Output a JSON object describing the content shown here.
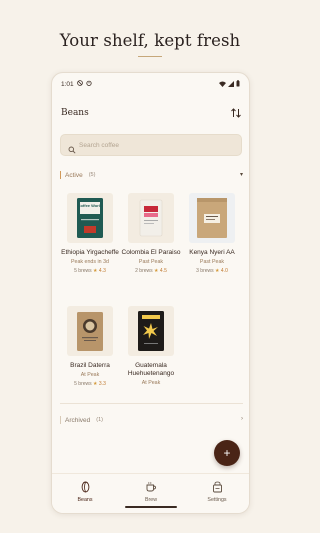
{
  "headline": "Your shelf, kept fresh",
  "status_bar": {
    "time": "1:01"
  },
  "appbar": {
    "title": "Beans",
    "sort_icon": "sort-arrows-icon"
  },
  "search": {
    "placeholder": "Search coffee",
    "value": ""
  },
  "active_section": {
    "label": "Active",
    "count": "(5)",
    "beans": [
      {
        "name": "Ethiopia Yirgacheffe",
        "status": "Peak ends in 3d",
        "brews": "5 brews",
        "rating": "4.3",
        "bag_color": "#1f5a52",
        "label_text": "Coffee World"
      },
      {
        "name": "Colombia El Paraiso",
        "status": "Past Peak",
        "brews": "2 brews",
        "rating": "4.5",
        "bag_color": "#f2efe9"
      },
      {
        "name": "Kenya Nyeri AA",
        "status": "Past Peak",
        "brews": "3 brews",
        "rating": "4.0",
        "bag_color": "#c9a77a"
      },
      {
        "name": "Brazil Daterra",
        "status": "At Peak",
        "brews": "5 brews",
        "rating": "3.3",
        "bag_color": "#b8956a"
      },
      {
        "name": "Guatemala Huehuetenango",
        "status": "At Peak",
        "bag_color": "#1e1b19"
      }
    ]
  },
  "archived_section": {
    "label": "Archived",
    "count": "(1)"
  },
  "fab": {
    "label": "+"
  },
  "bottom_nav": {
    "items": [
      {
        "label": "Beans",
        "icon": "coffee-bean-icon",
        "active": true
      },
      {
        "label": "Brew",
        "icon": "coffee-cup-icon",
        "active": false
      },
      {
        "label": "Settings",
        "icon": "settings-icon",
        "active": false
      }
    ]
  }
}
